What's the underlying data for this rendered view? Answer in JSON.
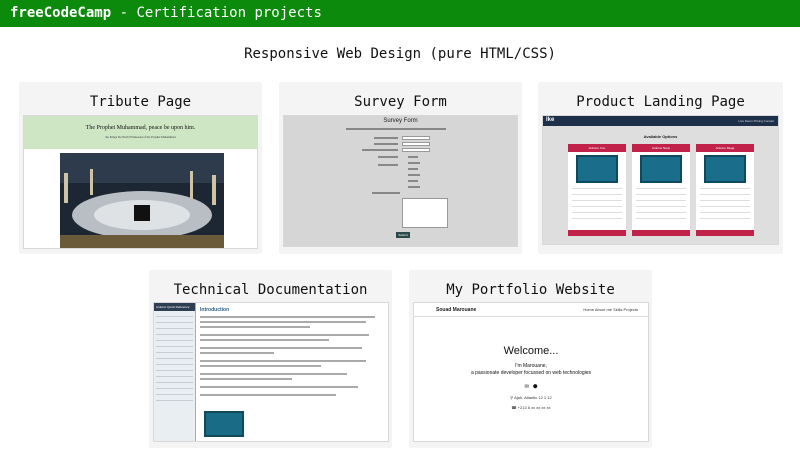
{
  "header": {
    "brand": "freeCodeCamp",
    "subtitle": " - Certification projects"
  },
  "section_title": "Responsive Web Design (pure HTML/CSS)",
  "cards": {
    "tribute": {
      "title": "Tribute Page",
      "preview_heading": "The Prophet Muhammad, peace be upon him.",
      "preview_subheading": "the things the World Witnessed of the Prophet Muhammad"
    },
    "survey": {
      "title": "Survey Form",
      "preview_heading": "Survey Form",
      "submit": "Submit"
    },
    "product": {
      "title": "Product Landing Page",
      "logo": "Ike",
      "nav": "Live Demo   Pricing   Contact",
      "heading": "Available Options",
      "options": [
        "Arduino Uno",
        "Arduino Nano",
        "Arduino Mega"
      ]
    },
    "techdoc": {
      "title": "Technical Documentation",
      "nav_head": "Arduino Quick Reference",
      "section_heading": "Introduction"
    },
    "portfolio": {
      "title": "My Portfolio Website",
      "logo": "Souad Marouane",
      "nav": "Home   About me   Skills   Projects",
      "welcome": "Welcome...",
      "name": "I'm Marouane,",
      "tagline": "a passionate developer focussed on web technologies",
      "location": "Ajah, Atlantic 12 1 12",
      "phone": "+213 6 xx xx xx xx"
    }
  },
  "icons": {
    "email": "envelope-icon",
    "github": "github-icon",
    "location": "map-pin-icon",
    "phone": "phone-icon"
  },
  "colors": {
    "header_bg": "#0c8a0c",
    "card_bg": "#f3f4f3",
    "product_accent": "#c0224a"
  }
}
